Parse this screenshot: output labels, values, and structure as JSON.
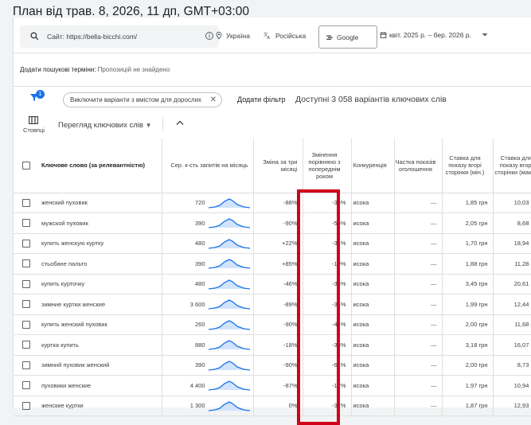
{
  "page_title": "План від трав. 8, 2026, 11 дп, GMT+03:00",
  "search": {
    "site_label": "Сайт: https://bella-bicchi.com/"
  },
  "location": "Україна",
  "language": "Російська",
  "network": "Google",
  "date_range": "квіт. 2025 р. – бер. 2026 р.",
  "add_terms": {
    "label": "Додати пошукові терміни:",
    "value": "Пропозицій не знайдено"
  },
  "filters": {
    "badge_count": "1",
    "chip_label": "Виключити варіанти з вмістом для дорослих",
    "add_filter_label": "Додати фільтр",
    "available_label": "Доступні 3 058 варіантів ключових слів"
  },
  "toolbar": {
    "columns_label": "Стовпці",
    "view_label": "Перегляд ключових слів"
  },
  "table": {
    "headers": {
      "keyword": "Ключове слово (за релевантністю)",
      "avg": "Сер. к-сть запитів на місяць",
      "three_month": "Зміна за три місяці",
      "yoy": "Змінення порівняно з попереднім роком",
      "competition": "Конкуренція",
      "share": "Частка показів оголошення",
      "bid_low": "Ставка для показу вгорі сторінки (мін.)",
      "bid_high": "Ставка для показу вгорі сторінки (макс.)"
    },
    "rows": [
      {
        "keyword": "женский пуховик",
        "avg": "720",
        "three_month": "-88%",
        "yoy": "-35%",
        "competition": "исока",
        "share": "—",
        "bid_low": "1,85 грн",
        "bid_high": "10,03 грн"
      },
      {
        "keyword": "мужской пуховик",
        "avg": "390",
        "three_month": "-90%",
        "yoy": "-55%",
        "competition": "исока",
        "share": "—",
        "bid_low": "2,05 грн",
        "bid_high": "8,68 грн"
      },
      {
        "keyword": "купить женскую куртку",
        "avg": "480",
        "three_month": "+22%",
        "yoy": "-34%",
        "competition": "исока",
        "share": "—",
        "bid_low": "1,70 грн",
        "bid_high": "18,94 грн"
      },
      {
        "keyword": "стьобане пальто",
        "avg": "390",
        "three_month": "+85%",
        "yoy": "-19%",
        "competition": "исока",
        "share": "—",
        "bid_low": "1,88 грн",
        "bid_high": "11,28 грн"
      },
      {
        "keyword": "купить курточку",
        "avg": "480",
        "three_month": "-46%",
        "yoy": "-33%",
        "competition": "исока",
        "share": "—",
        "bid_low": "3,45 грн",
        "bid_high": "20,61 грн"
      },
      {
        "keyword": "зимние куртки женские",
        "avg": "3 600",
        "three_month": "-89%",
        "yoy": "-34%",
        "competition": "исока",
        "share": "—",
        "bid_low": "1,99 грн",
        "bid_high": "12,44 грн"
      },
      {
        "keyword": "купить женский пуховик",
        "avg": "260",
        "three_month": "-90%",
        "yoy": "-44%",
        "competition": "исока",
        "share": "—",
        "bid_low": "2,00 грн",
        "bid_high": "11,68 грн"
      },
      {
        "keyword": "куртка купить",
        "avg": "880",
        "three_month": "-18%",
        "yoy": "-33%",
        "competition": "исока",
        "share": "—",
        "bid_low": "3,18 грн",
        "bid_high": "16,07 грн"
      },
      {
        "keyword": "зимний пуховик женский",
        "avg": "390",
        "three_month": "-90%",
        "yoy": "-64%",
        "competition": "исока",
        "share": "—",
        "bid_low": "2,00 грн",
        "bid_high": "8,73 грн"
      },
      {
        "keyword": "пуховики женские",
        "avg": "4 400",
        "three_month": "-87%",
        "yoy": "-12%",
        "competition": "исока",
        "share": "—",
        "bid_low": "1,97 грн",
        "bid_high": "10,94 грн"
      },
      {
        "keyword": "женские куртки",
        "avg": "1 300",
        "three_month": "0%",
        "yoy": "-32%",
        "competition": "исока",
        "share": "—",
        "bid_low": "1,87 грн",
        "bid_high": "12,93 грн"
      }
    ]
  },
  "colors": {
    "accent": "#1a73e8",
    "highlight": "#d0021b"
  },
  "icons": [
    "search-icon",
    "info-icon",
    "location-pin-icon",
    "translate-icon",
    "calendar-icon",
    "dropdown-arrow-icon",
    "filter-icon",
    "close-icon",
    "columns-icon",
    "chevron-up-icon",
    "sparkline-icon"
  ]
}
